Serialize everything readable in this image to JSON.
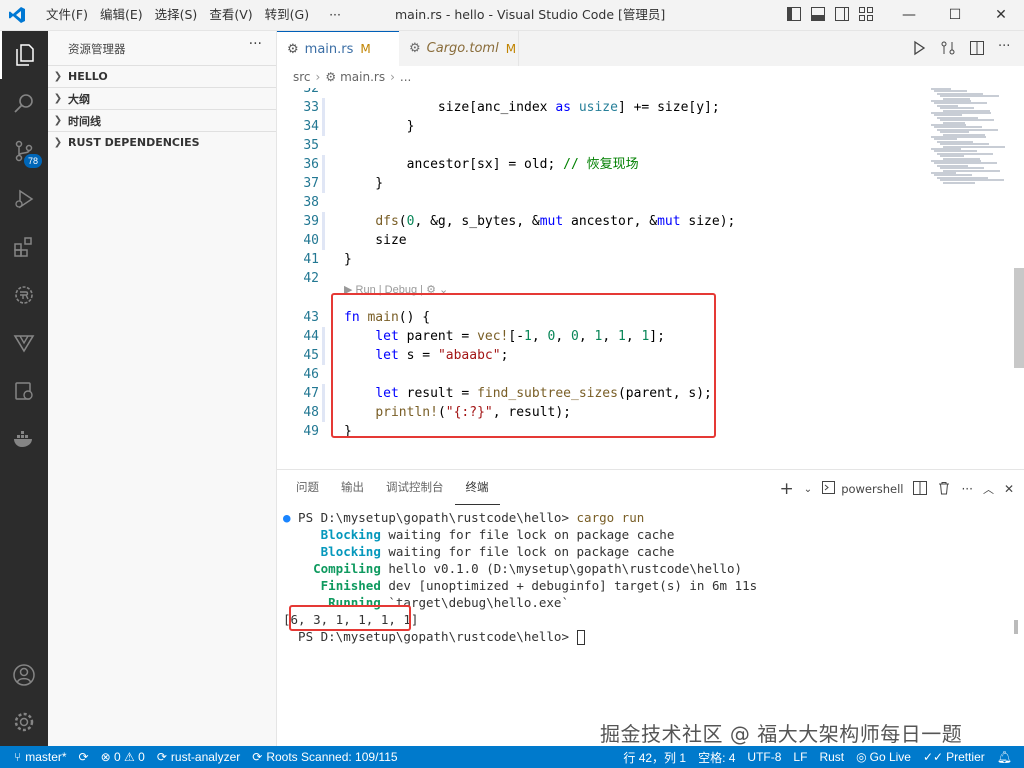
{
  "window": {
    "title": "main.rs - hello - Visual Studio Code [管理员]",
    "menus": [
      "文件(F)",
      "编辑(E)",
      "选择(S)",
      "查看(V)",
      "转到(G)",
      "···"
    ]
  },
  "activity_bar": {
    "scm_badge": "78"
  },
  "sidebar": {
    "title": "资源管理器",
    "more": "···",
    "sections": [
      "HELLO",
      "大纲",
      "时间线",
      "RUST DEPENDENCIES"
    ]
  },
  "tabs": [
    {
      "label": "main.rs",
      "modified": "M",
      "icon": "rust-file-icon"
    },
    {
      "label": "Cargo.toml",
      "modified": "M",
      "icon": "gear-icon"
    }
  ],
  "breadcrumb": [
    "src",
    "main.rs",
    "..."
  ],
  "editor": {
    "codelens": "▶ Run | Debug | ",
    "lines": [
      {
        "n": "32",
        "html": ""
      },
      {
        "n": "33",
        "html": "            size[anc_index <span class='kw'>as</span> <span class='ty'>usize</span>] += size[y];"
      },
      {
        "n": "34",
        "html": "        }"
      },
      {
        "n": "35",
        "html": ""
      },
      {
        "n": "36",
        "html": "        ancestor[sx] = old; <span class='cmt'>// 恢复现场</span>"
      },
      {
        "n": "37",
        "html": "    }"
      },
      {
        "n": "38",
        "html": ""
      },
      {
        "n": "39",
        "html": "    <span class='fn'>dfs</span>(<span class='num'>0</span>, &amp;g, s_bytes, &amp;<span class='kw'>mut</span> ancestor, &amp;<span class='kw'>mut</span> size);"
      },
      {
        "n": "40",
        "html": "    size"
      },
      {
        "n": "41",
        "html": "}"
      },
      {
        "n": "42",
        "html": ""
      },
      {
        "n": "43",
        "html": "<span class='kw'>fn</span> <span class='fn'>main</span>() {"
      },
      {
        "n": "44",
        "html": "    <span class='kw'>let</span> parent = <span class='mac'>vec!</span>[-<span class='num'>1</span>, <span class='num'>0</span>, <span class='num'>0</span>, <span class='num'>1</span>, <span class='num'>1</span>, <span class='num'>1</span>];"
      },
      {
        "n": "45",
        "html": "    <span class='kw'>let</span> s = <span class='str'>\"abaabc\"</span>;"
      },
      {
        "n": "46",
        "html": ""
      },
      {
        "n": "47",
        "html": "    <span class='kw'>let</span> result = <span class='fn'>find_subtree_sizes</span>(parent, s);"
      },
      {
        "n": "48",
        "html": "    <span class='mac'>println!</span>(<span class='str'>\"{:?}\"</span>, result);"
      },
      {
        "n": "49",
        "html": "}"
      }
    ]
  },
  "panel": {
    "tabs": [
      "问题",
      "输出",
      "调试控制台",
      "终端"
    ],
    "active_tab": "终端",
    "shell": "powershell",
    "terminal": [
      {
        "html": "<span class='dot'>●</span> PS D:\\mysetup\\gopath\\rustcode\\hello&gt; <span class='tcmd'>cargo run</span>"
      },
      {
        "html": "     <span class='tg'>Blocking</span> waiting for file lock on package cache"
      },
      {
        "html": "     <span class='tg'>Blocking</span> waiting for file lock on package cache"
      },
      {
        "html": "    <span class='tgr'>Compiling</span> hello v0.1.0 (D:\\mysetup\\gopath\\rustcode\\hello)"
      },
      {
        "html": "     <span class='tgr'>Finished</span> dev [unoptimized + debuginfo] target(s) in 6m 11s"
      },
      {
        "html": "      <span class='tgr'>Running</span> `target\\debug\\hello.exe`"
      },
      {
        "html": "[6, 3, 1, 1, 1, 1]"
      },
      {
        "html": "  PS D:\\mysetup\\gopath\\rustcode\\hello&gt; <span class='cursor'></span>"
      }
    ]
  },
  "watermark": "掘金技术社区 @ 福大大架构师每日一题",
  "statusbar": {
    "branch": "master*",
    "problems": "0",
    "warnings": "0",
    "rust_analyzer": "rust-analyzer",
    "roots": "Roots Scanned: 109/115",
    "position": "行 42，列 1",
    "spaces": "空格: 4",
    "encoding": "UTF-8",
    "eol": "LF",
    "language": "Rust",
    "golive": "Go Live",
    "prettier": "Prettier"
  }
}
